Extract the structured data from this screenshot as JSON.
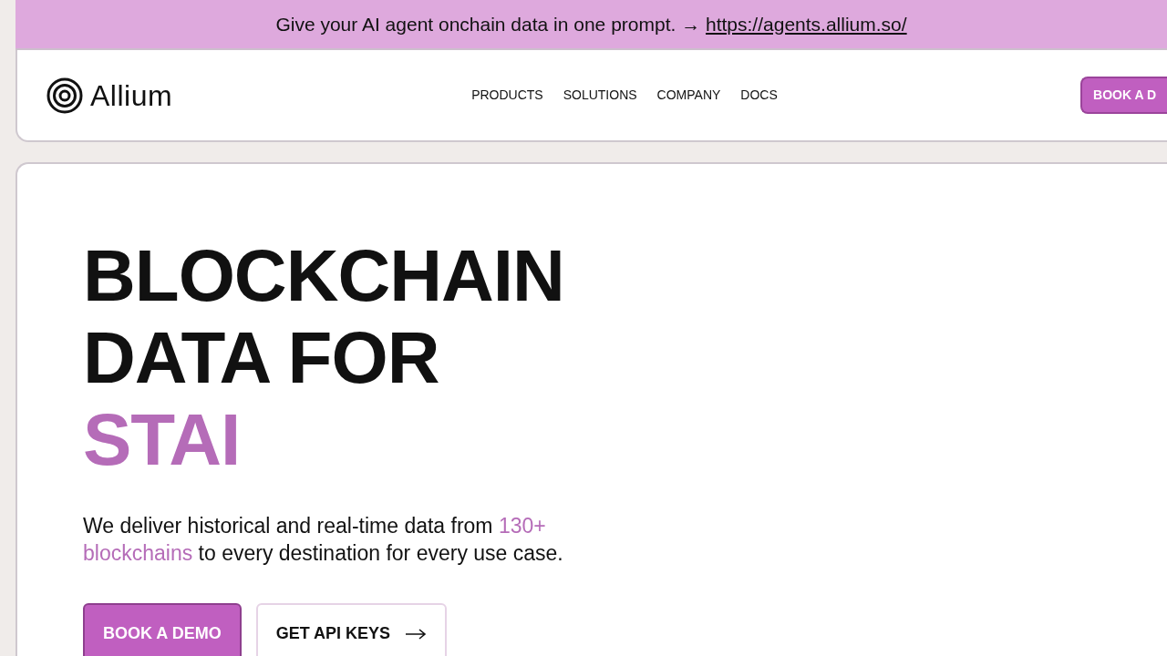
{
  "banner": {
    "text": "Give your AI agent onchain data in one prompt. →",
    "link": "https://agents.allium.so/"
  },
  "header": {
    "logo": "Allium",
    "nav": [
      "PRODUCTS",
      "SOLUTIONS",
      "COMPANY",
      "DOCS"
    ],
    "cta": "BOOK A D"
  },
  "hero": {
    "title_lines": [
      {
        "text": "BLOCKCHAIN",
        "accent": false
      },
      {
        "text": "DATA FOR",
        "accent": false
      },
      {
        "text": "STAI",
        "accent": true
      }
    ],
    "description": [
      {
        "text": "We deliver historical and real-time data from ",
        "accent": false
      },
      {
        "text": "130+ blockchains",
        "accent": true
      },
      {
        "text": " to every destination for every use case.",
        "accent": false
      }
    ],
    "buttons": [
      {
        "label": "BOOK A DEMO",
        "kind": "primary"
      },
      {
        "label": "GET API KEYS",
        "kind": "secondary"
      }
    ]
  }
}
